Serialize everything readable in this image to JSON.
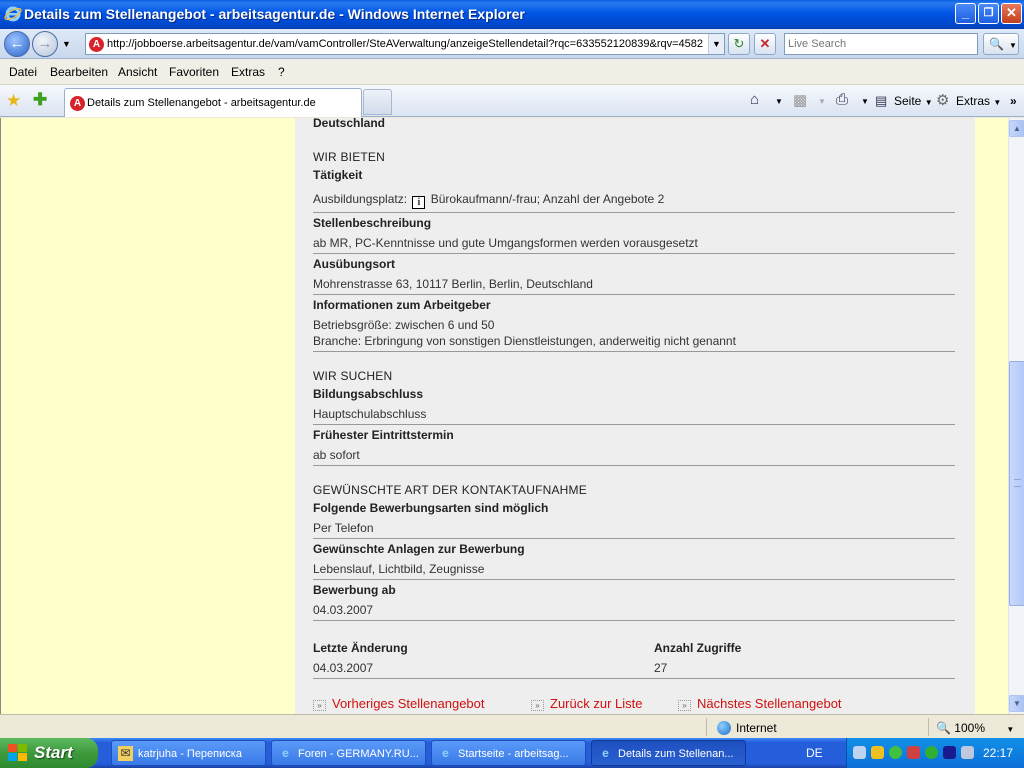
{
  "window": {
    "title": "Details zum Stellenangebot - arbeitsagentur.de - Windows Internet Explorer",
    "minimize": "_",
    "maximize": "❐",
    "close": "✕"
  },
  "address_bar": {
    "url": "http://jobboerse.arbeitsagentur.de/vam/vamController/SteAVerwaltung/anzeigeStellendetail?rqc=633552120839&rqv=4582",
    "search_placeholder": "Live Search"
  },
  "menu": [
    "Datei",
    "Bearbeiten",
    "Ansicht",
    "Favoriten",
    "Extras",
    "?"
  ],
  "tab": {
    "label": "Details zum Stellenangebot - arbeitsagentur.de"
  },
  "command_bar": {
    "page_label": "Seite",
    "tools_label": "Extras"
  },
  "page": {
    "top_cut": "Deutschland",
    "offer": {
      "heading": "WIR BIETEN",
      "activity_label": "Tätigkeit",
      "activity_prefix": "Ausbildungsplatz:",
      "activity_value": "Bürokaufmann/-frau; Anzahl der Angebote 2",
      "description_label": "Stellenbeschreibung",
      "description_value": "ab MR, PC-Kenntnisse und gute Umgangsformen werden vorausgesetzt",
      "location_label": "Ausübungsort",
      "location_value": "Mohrenstrasse 63, 10117 Berlin, Berlin, Deutschland",
      "employer_label": "Informationen zum Arbeitgeber",
      "employer_size": "Betriebsgröße: zwischen 6 und 50",
      "employer_branch": "Branche: Erbringung von sonstigen Dienstleistungen, anderweitig nicht genannt"
    },
    "seeking": {
      "heading": "WIR SUCHEN",
      "education_label": "Bildungsabschluss",
      "education_value": "Hauptschulabschluss",
      "start_label": "Frühester Eintrittstermin",
      "start_value": "ab sofort"
    },
    "contact": {
      "heading": "GEWÜNSCHTE ART DER KONTAKTAUFNAHME",
      "methods_label": "Folgende Bewerbungsarten sind möglich",
      "methods_value": "Per Telefon",
      "attachments_label": "Gewünschte Anlagen zur Bewerbung",
      "attachments_value": "Lebenslauf, Lichtbild, Zeugnisse",
      "apply_from_label": "Bewerbung ab",
      "apply_from_value": "04.03.2007"
    },
    "meta": {
      "last_change_label": "Letzte Änderung",
      "last_change_value": "04.03.2007",
      "hits_label": "Anzahl Zugriffe",
      "hits_value": "27"
    },
    "nav": {
      "prev": "Vorheriges Stellenangebot",
      "back": "Zurück zur Liste",
      "next": "Nächstes Stellenangebot"
    }
  },
  "status_bar": {
    "zone": "Internet",
    "zoom": "100%"
  },
  "taskbar": {
    "start": "Start",
    "items": [
      "katrjuha - Переписка",
      "Foren - GERMANY.RU...",
      "Startseite - arbeitsag...",
      "Details zum Stellenan..."
    ],
    "language": "DE",
    "clock": "22:17"
  },
  "colors": {
    "page_background": "#ffffcc",
    "content_background": "#eeeeee",
    "link_red": "#d01010",
    "xp_blue": "#245edb",
    "start_green": "#3c9a3c"
  }
}
